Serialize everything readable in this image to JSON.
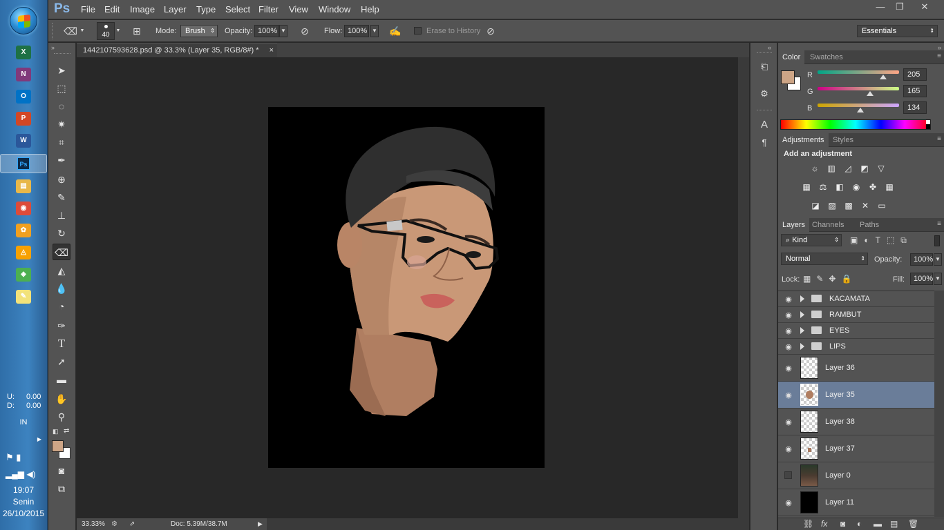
{
  "taskbar": {
    "apps": [
      {
        "name": "excel",
        "glyph": "X",
        "color": "#1e7145"
      },
      {
        "name": "onenote",
        "glyph": "N",
        "color": "#80397b"
      },
      {
        "name": "outlook",
        "glyph": "O",
        "color": "#0072c6"
      },
      {
        "name": "powerpoint",
        "glyph": "P",
        "color": "#d24726"
      },
      {
        "name": "word",
        "glyph": "W",
        "color": "#2b579a"
      },
      {
        "name": "photoshop",
        "glyph": "Ps",
        "color": "#31a8ff"
      },
      {
        "name": "explorer",
        "glyph": "▤",
        "color": "#e8b84a"
      },
      {
        "name": "chrome",
        "glyph": "◉",
        "color": "#dd4b39"
      },
      {
        "name": "app-yellow",
        "glyph": "✿",
        "color": "#f0a020"
      },
      {
        "name": "app-orange",
        "glyph": "◬",
        "color": "#f7a100"
      },
      {
        "name": "app-green",
        "glyph": "◈",
        "color": "#4caf50"
      },
      {
        "name": "notepad",
        "glyph": "✎",
        "color": "#f2e27a"
      }
    ],
    "net_u": "U:",
    "net_u_val": "0.00",
    "net_d": "D:",
    "net_d_val": "0.00",
    "lang": "IN",
    "time": "19:07",
    "day": "Senin",
    "date": "26/10/2015"
  },
  "menubar": {
    "logo": "Ps",
    "items": [
      "File",
      "Edit",
      "Image",
      "Layer",
      "Type",
      "Select",
      "Filter",
      "View",
      "Window",
      "Help"
    ]
  },
  "options": {
    "brush_size": "40",
    "mode_label": "Mode:",
    "mode_value": "Brush",
    "opacity_label": "Opacity:",
    "opacity_value": "100%",
    "flow_label": "Flow:",
    "flow_value": "100%",
    "erase_history_label": "Erase to History",
    "workspace": "Essentials"
  },
  "document": {
    "tab_title": "1442107593628.psd @ 33.3% (Layer 35, RGB/8#) *",
    "close": "×"
  },
  "status": {
    "zoom": "33.33%",
    "doc_info": "Doc: 5.39M/38.7M"
  },
  "color_panel": {
    "tabs": [
      "Color",
      "Swatches"
    ],
    "foreground": "#cda586",
    "channels": [
      {
        "label": "R",
        "value": "205",
        "level": 0.804
      },
      {
        "label": "G",
        "value": "165",
        "level": 0.647
      },
      {
        "label": "B",
        "value": "134",
        "level": 0.525
      }
    ]
  },
  "adjustments_panel": {
    "tabs": [
      "Adjustments",
      "Styles"
    ],
    "heading": "Add an adjustment",
    "row1": [
      "brightness-contrast-icon",
      "levels-icon",
      "curves-icon",
      "exposure-icon",
      "vibrance-icon"
    ],
    "row1_glyphs": [
      "☼",
      "▥",
      "◿",
      "◩",
      "▽"
    ],
    "row2": [
      "hue-saturation-icon",
      "color-balance-icon",
      "black-white-icon",
      "photo-filter-icon",
      "channel-mixer-icon",
      "color-lookup-icon"
    ],
    "row2_glyphs": [
      "▦",
      "⚖",
      "◧",
      "◉",
      "✤",
      "▦"
    ],
    "row3": [
      "invert-icon",
      "posterize-icon",
      "threshold-icon",
      "selective-color-icon",
      "gradient-map-icon"
    ],
    "row3_glyphs": [
      "◪",
      "▨",
      "▩",
      "✕",
      "▭"
    ]
  },
  "layers_panel": {
    "tabs": [
      "Layers",
      "Channels",
      "Paths"
    ],
    "filter_kind": "Kind",
    "blend_mode": "Normal",
    "opacity_label": "Opacity:",
    "opacity_value": "100%",
    "lock_label": "Lock:",
    "fill_label": "Fill:",
    "fill_value": "100%",
    "groups": [
      "KACAMATA",
      "RAMBUT",
      "EYES",
      "LIPS"
    ],
    "layers": [
      {
        "name": "Layer 36",
        "visible": true,
        "selected": false,
        "thumb": "transparent"
      },
      {
        "name": "Layer 35",
        "visible": true,
        "selected": true,
        "thumb": "face"
      },
      {
        "name": "Layer 38",
        "visible": true,
        "selected": false,
        "thumb": "transparent"
      },
      {
        "name": "Layer 37",
        "visible": true,
        "selected": false,
        "thumb": "small"
      },
      {
        "name": "Layer 0",
        "visible": false,
        "selected": false,
        "thumb": "photo"
      },
      {
        "name": "Layer 11",
        "visible": true,
        "selected": false,
        "thumb": "black"
      }
    ]
  }
}
